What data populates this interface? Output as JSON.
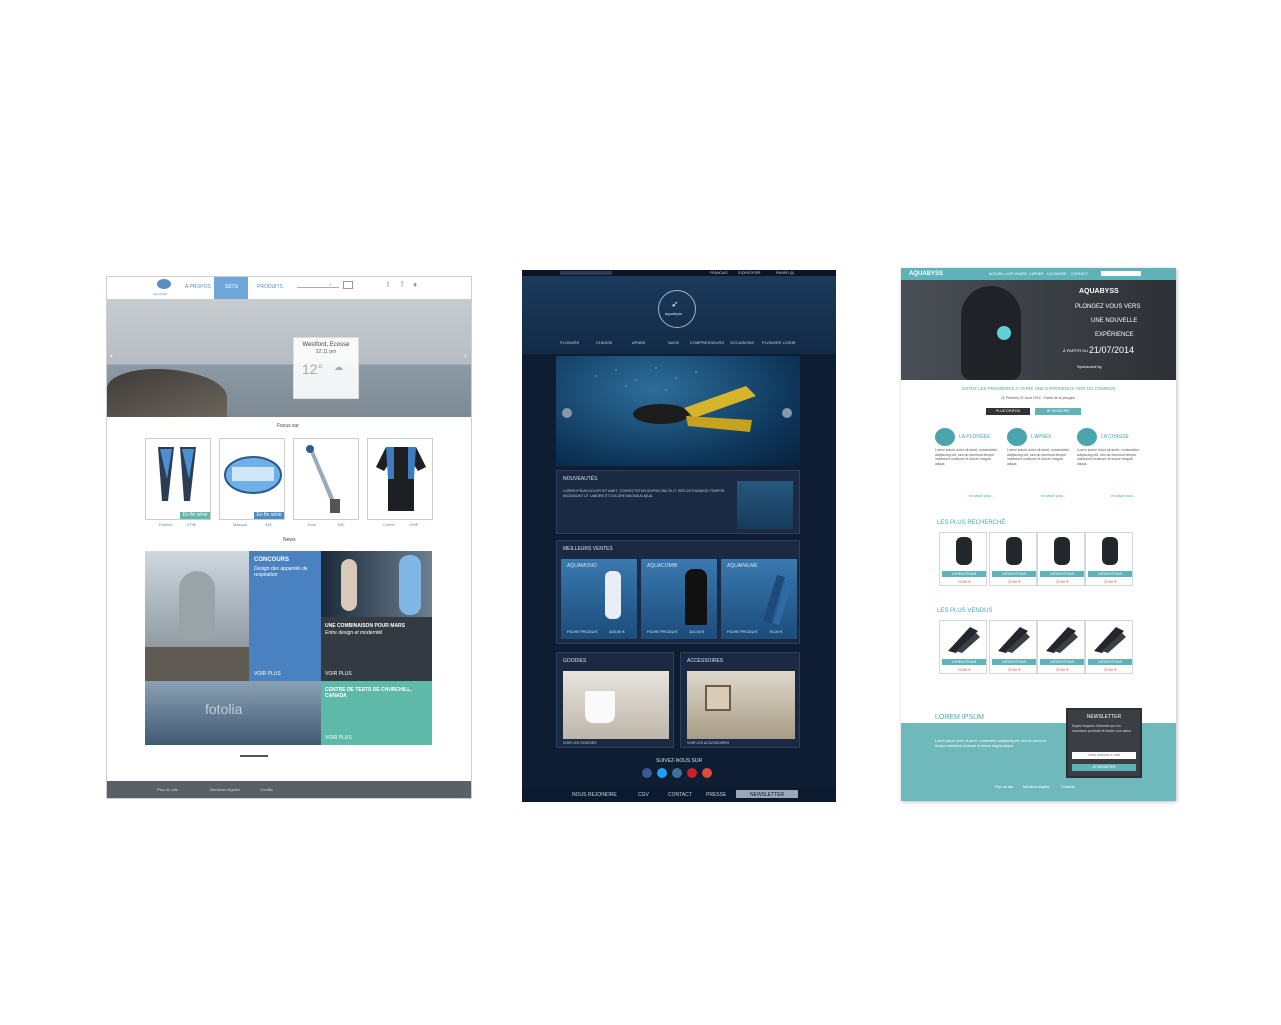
{
  "mockup1": {
    "logo_text": "AQUAYSS",
    "nav": [
      "A PROPOS",
      "SETS",
      "PRODUITS"
    ],
    "hero": {
      "location": "Westford, Ecosse",
      "time": "22:11 pm",
      "temp": "12°",
      "prev_arrow": "‹",
      "next_arrow": "›"
    },
    "section_title": "Focus sur",
    "products": [
      {
        "name": "Palmes",
        "price": "279€",
        "badge": "En fin série"
      },
      {
        "name": "Masque",
        "price": "34€",
        "badge": "En fin série"
      },
      {
        "name": "Tuba",
        "price": "19€",
        "badge": ""
      },
      {
        "name": "Combi",
        "price": "199€",
        "badge": ""
      }
    ],
    "news_title": "News",
    "news": {
      "concours_title": "CONCOURS",
      "concours_sub": "Design des appareils de respiration",
      "concours_more": "VOIR PLUS",
      "combi_title": "UNE COMBINAISON POUR MARS",
      "combi_sub": "Entre design et modernité",
      "combi_more": "VOIR PLUS",
      "centre_title": "CENTRE DE TESTS DE CHURCHILL, CANADA",
      "centre_more": "VOIR PLUS",
      "watermark": "fotolia"
    },
    "footer": [
      "Plan du site",
      "Mentions légales",
      "Credits"
    ]
  },
  "mockup2": {
    "top_links": [
      "FRANCAIS",
      "S'IDENTIFIER",
      "PANIER (0)"
    ],
    "logo": "aquabyss",
    "menu": [
      "PLONGÉE",
      "CHASSE",
      "APNÉE",
      "NAGE",
      "COMPRESSEURS",
      "OCCASIONS",
      "PLONGÉE LOISIR"
    ],
    "nouveautes_title": "NOUVEAUTÉS",
    "nouveautes_text": "LOREM IPSUM DOLOR SIT AMET, CONSECTETUR ADIPISICING ELIT, SED DO EIUSMOD TEMPOR INCIDIDUNT UT LABORE ET DOLORE MAGNA ALIQUA.",
    "ventes_title": "MEILLEURS VENTES",
    "ventes": [
      {
        "name": "AQUAMONO",
        "price": "428,00 €",
        "cta": "FICHE PRODUIT",
        "info": "12 L MONO\n2 SORTIES\n232 BARS"
      },
      {
        "name": "AQUACOMBI",
        "price": "114,00 €",
        "cta": "FICHE PRODUIT",
        "info": "COMBI-ETE"
      },
      {
        "name": "AQUAPALME",
        "price": "76,00 €",
        "cta": "FICHE PRODUIT",
        "info": "PALMES DROITES"
      }
    ],
    "goodies_title": "GOODIES",
    "goodies_cta": "VOIR LES GOODIES",
    "accessoires_title": "ACCESSOIRES",
    "accessoires_cta": "VOIR LES ACCESSOIRES",
    "suivez": "SUIVEZ-NOUS SUR",
    "footer": [
      "NOUS REJOINDRE",
      "CGV",
      "CONTACT",
      "PRESSE",
      "NEWSLETTER"
    ],
    "social_colors": [
      "#3b5998",
      "#1da1f2",
      "#3f729b",
      "#cb2027",
      "#dd4b39"
    ]
  },
  "mockup3": {
    "logo": "AQUABYSS",
    "nav": [
      "ACCUEIL",
      "LA PLONGÉE",
      "L'APNÉE",
      "LA CHASSE",
      "CONTACT"
    ],
    "hero_logo": "AQUABYSS",
    "hero_lines": [
      "PLONGEZ VOUS VERS",
      "UNE NOUVELLE",
      "EXPÉRIENCE"
    ],
    "hero_date_prefix": "À PARTIR DU",
    "hero_date": "21/07/2014",
    "hero_sponsor": "Sponsored by",
    "tagline": "SOYEZ LES PREMIÈRES À VIVRE UNE EXPÉRIENCE HOR DU COMMUN",
    "tagline_sub": "(À Présent) 21 Aout 2014 · Partie de la plongée.",
    "btn_plus": "PLUS D'INFOS",
    "btn_achat": "JE M'INSCRIS",
    "sections": [
      {
        "title": "LA PLONGÉE",
        "more": "en savoir plus..."
      },
      {
        "title": "L'APNÉE",
        "more": "en savoir plus..."
      },
      {
        "title": "LA CHASSE",
        "more": "en savoir plus..."
      }
    ],
    "lorem_short": "Lorem ipsum dolor sit amet, consectetur adipiscing elit, sed do eiusmod tempor incididunt ut labore et dolore magna aliqua.",
    "recherche_title": "LES PLUS RECHERCHÉ",
    "vendus_title": "LES PLUS VENDUS",
    "card_label": "LOREM IPSUM",
    "card_price": "79,60 €",
    "bottom_title": "LOREM IPSUM",
    "bottom_text": "Lorem ipsum dolor sit amet, consectetur adipiscing elit, sed do eiusmod tempor incididunt ut labore et dolore magna aliqua.",
    "newsletter_title": "NEWSLETTER",
    "newsletter_text": "Soyez toujours informés sur les nouveaux produits et toutes nos actus",
    "newsletter_placeholder": "Votre adresse e-mail",
    "newsletter_btn": "JE M'INSCRIS",
    "footer": [
      "Plan du site",
      "Mentions légales",
      "Contacts"
    ]
  }
}
